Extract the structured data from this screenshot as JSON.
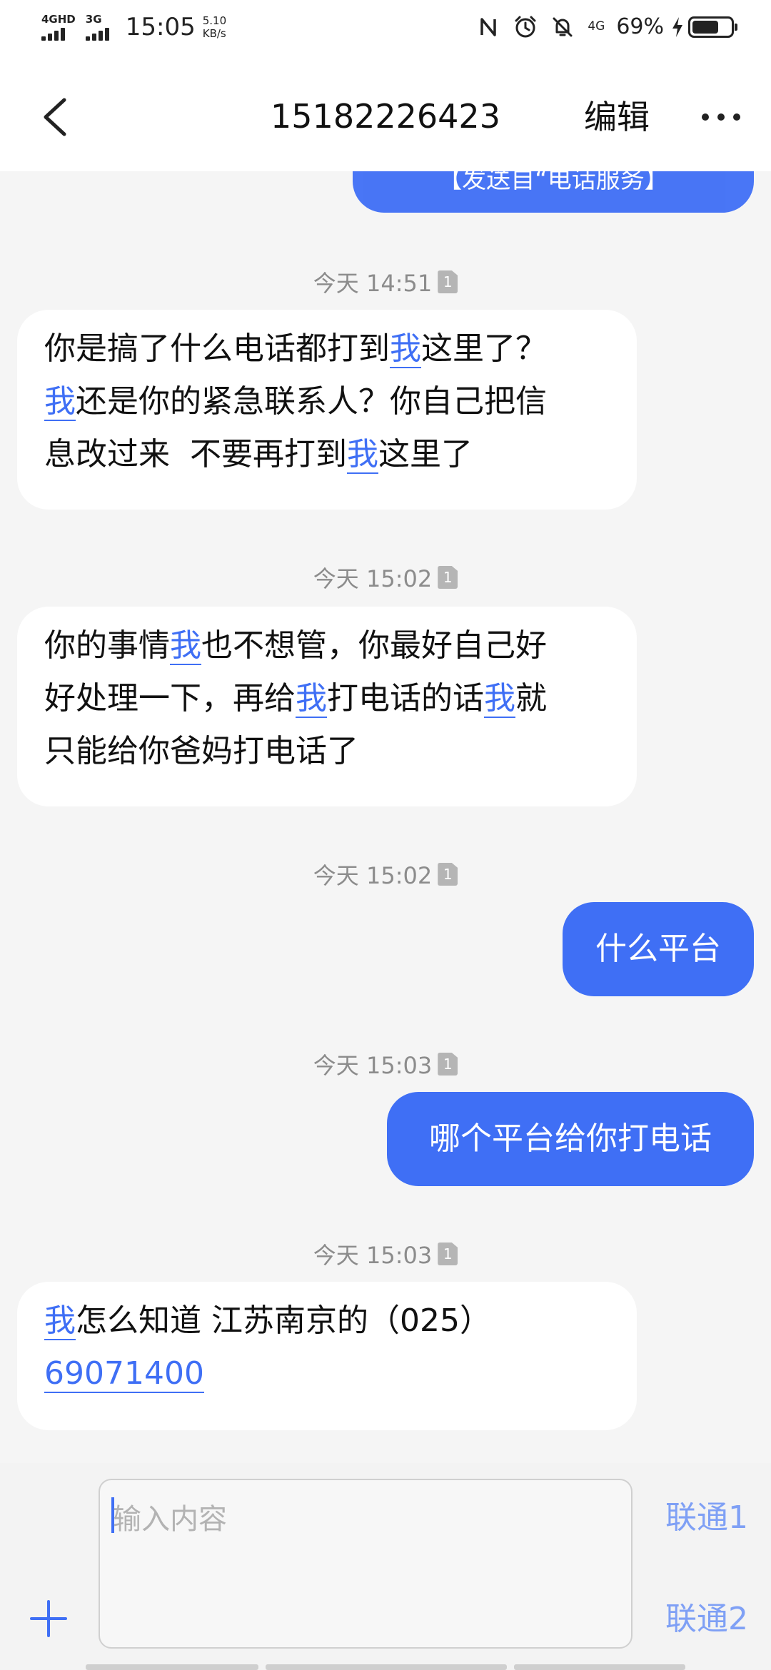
{
  "status_bar": {
    "net1": "4GHD",
    "net2": "3G",
    "time": "15:05",
    "speed_value": "5.10",
    "speed_unit": "KB/s",
    "net_right": "4G",
    "battery_percent": "69%",
    "battery_level": 0.69
  },
  "header": {
    "title": "15182226423",
    "edit": "编辑",
    "back_icon": "chevron-left-icon",
    "more_icon": "more-horizontal-icon"
  },
  "conversation": {
    "partial_top_text": "【发送自“电话服务】",
    "timestamps": [
      "今天 14:51",
      "今天 15:02",
      "今天 15:02",
      "今天 15:03",
      "今天 15:03"
    ],
    "sim_badge": "1",
    "messages": [
      {
        "direction": "incoming",
        "lines": [
          [
            "你是搞了什么电话都打到",
            "我",
            "这里了？"
          ],
          [
            "我",
            "还是你的紧急联系人？你自己把信"
          ],
          [
            "息改过来  不要再打到",
            "我",
            "这里了"
          ]
        ]
      },
      {
        "direction": "incoming",
        "lines": [
          [
            "你的事情",
            "我",
            "也不想管，你最好自己好"
          ],
          [
            "好处理一下，再给",
            "我",
            "打电话的话",
            "我",
            "就"
          ],
          [
            "只能给你爸妈打电话了"
          ]
        ]
      },
      {
        "direction": "outgoing",
        "text": "什么平台"
      },
      {
        "direction": "outgoing",
        "text": "哪个平台给你打电话"
      },
      {
        "direction": "incoming",
        "lines": [
          [
            "我",
            "怎么知道 江苏南京的（025）"
          ],
          [
            "69071400"
          ]
        ]
      }
    ]
  },
  "input": {
    "placeholder": "输入内容",
    "sim1": "联通1",
    "sim2": "联通2"
  },
  "colors": {
    "accent": "#3f6ff5",
    "sim_send": "#7fa0f5",
    "background": "#f5f5f5"
  }
}
